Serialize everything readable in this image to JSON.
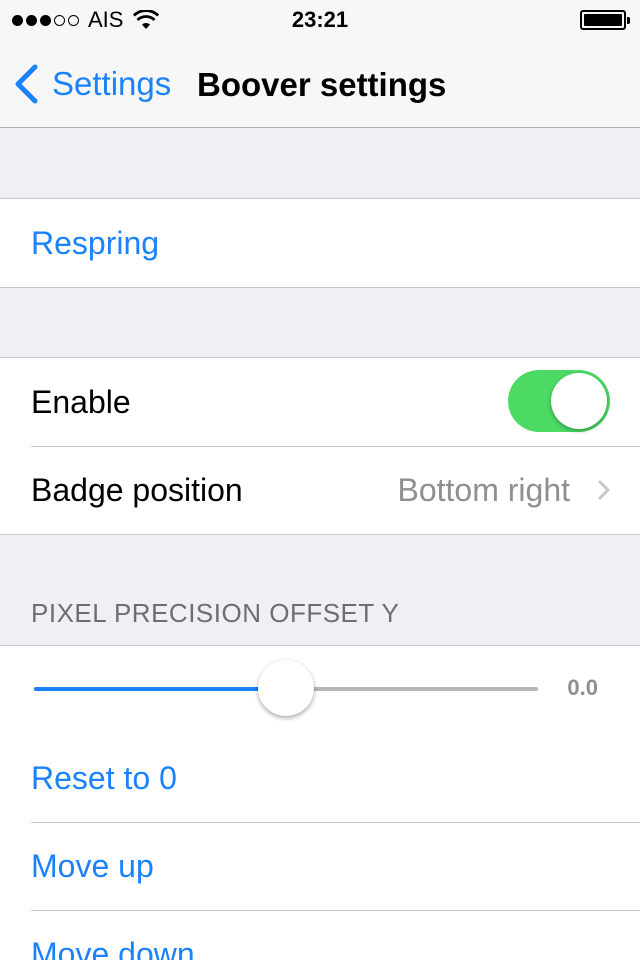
{
  "status_bar": {
    "carrier": "AIS",
    "time": "23:21",
    "signal_bars_filled": 3,
    "signal_bars_total": 5
  },
  "nav": {
    "back_label": "Settings",
    "title": "Boover settings"
  },
  "groups": {
    "respring_label": "Respring",
    "enable_label": "Enable",
    "enable_on": true,
    "badge_position_label": "Badge position",
    "badge_position_value": "Bottom right"
  },
  "pixel_section": {
    "header": "PIXEL PRECISION OFFSET Y",
    "slider_value": "0.0",
    "slider_fraction": 0.5,
    "reset_label": "Reset to 0",
    "move_up_label": "Move up",
    "move_down_label": "Move down"
  },
  "colors": {
    "accent": "#1a82fb",
    "switch_on": "#4cd964",
    "background": "#efeff4"
  }
}
